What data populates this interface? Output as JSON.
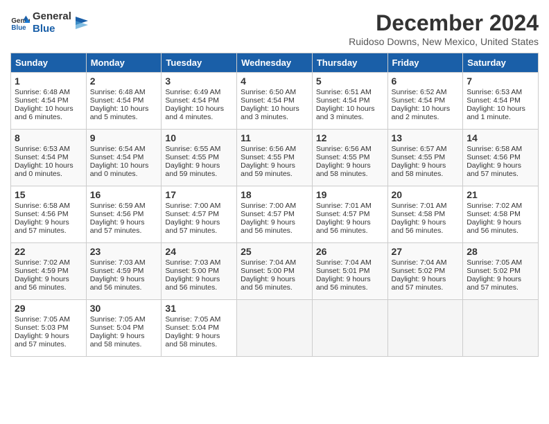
{
  "header": {
    "logo_line1": "General",
    "logo_line2": "Blue",
    "month": "December 2024",
    "location": "Ruidoso Downs, New Mexico, United States"
  },
  "weekdays": [
    "Sunday",
    "Monday",
    "Tuesday",
    "Wednesday",
    "Thursday",
    "Friday",
    "Saturday"
  ],
  "weeks": [
    [
      {
        "day": "1",
        "lines": [
          "Sunrise: 6:48 AM",
          "Sunset: 4:54 PM",
          "Daylight: 10 hours",
          "and 6 minutes."
        ]
      },
      {
        "day": "2",
        "lines": [
          "Sunrise: 6:48 AM",
          "Sunset: 4:54 PM",
          "Daylight: 10 hours",
          "and 5 minutes."
        ]
      },
      {
        "day": "3",
        "lines": [
          "Sunrise: 6:49 AM",
          "Sunset: 4:54 PM",
          "Daylight: 10 hours",
          "and 4 minutes."
        ]
      },
      {
        "day": "4",
        "lines": [
          "Sunrise: 6:50 AM",
          "Sunset: 4:54 PM",
          "Daylight: 10 hours",
          "and 3 minutes."
        ]
      },
      {
        "day": "5",
        "lines": [
          "Sunrise: 6:51 AM",
          "Sunset: 4:54 PM",
          "Daylight: 10 hours",
          "and 3 minutes."
        ]
      },
      {
        "day": "6",
        "lines": [
          "Sunrise: 6:52 AM",
          "Sunset: 4:54 PM",
          "Daylight: 10 hours",
          "and 2 minutes."
        ]
      },
      {
        "day": "7",
        "lines": [
          "Sunrise: 6:53 AM",
          "Sunset: 4:54 PM",
          "Daylight: 10 hours",
          "and 1 minute."
        ]
      }
    ],
    [
      {
        "day": "8",
        "lines": [
          "Sunrise: 6:53 AM",
          "Sunset: 4:54 PM",
          "Daylight: 10 hours",
          "and 0 minutes."
        ]
      },
      {
        "day": "9",
        "lines": [
          "Sunrise: 6:54 AM",
          "Sunset: 4:54 PM",
          "Daylight: 10 hours",
          "and 0 minutes."
        ]
      },
      {
        "day": "10",
        "lines": [
          "Sunrise: 6:55 AM",
          "Sunset: 4:55 PM",
          "Daylight: 9 hours",
          "and 59 minutes."
        ]
      },
      {
        "day": "11",
        "lines": [
          "Sunrise: 6:56 AM",
          "Sunset: 4:55 PM",
          "Daylight: 9 hours",
          "and 59 minutes."
        ]
      },
      {
        "day": "12",
        "lines": [
          "Sunrise: 6:56 AM",
          "Sunset: 4:55 PM",
          "Daylight: 9 hours",
          "and 58 minutes."
        ]
      },
      {
        "day": "13",
        "lines": [
          "Sunrise: 6:57 AM",
          "Sunset: 4:55 PM",
          "Daylight: 9 hours",
          "and 58 minutes."
        ]
      },
      {
        "day": "14",
        "lines": [
          "Sunrise: 6:58 AM",
          "Sunset: 4:56 PM",
          "Daylight: 9 hours",
          "and 57 minutes."
        ]
      }
    ],
    [
      {
        "day": "15",
        "lines": [
          "Sunrise: 6:58 AM",
          "Sunset: 4:56 PM",
          "Daylight: 9 hours",
          "and 57 minutes."
        ]
      },
      {
        "day": "16",
        "lines": [
          "Sunrise: 6:59 AM",
          "Sunset: 4:56 PM",
          "Daylight: 9 hours",
          "and 57 minutes."
        ]
      },
      {
        "day": "17",
        "lines": [
          "Sunrise: 7:00 AM",
          "Sunset: 4:57 PM",
          "Daylight: 9 hours",
          "and 57 minutes."
        ]
      },
      {
        "day": "18",
        "lines": [
          "Sunrise: 7:00 AM",
          "Sunset: 4:57 PM",
          "Daylight: 9 hours",
          "and 56 minutes."
        ]
      },
      {
        "day": "19",
        "lines": [
          "Sunrise: 7:01 AM",
          "Sunset: 4:57 PM",
          "Daylight: 9 hours",
          "and 56 minutes."
        ]
      },
      {
        "day": "20",
        "lines": [
          "Sunrise: 7:01 AM",
          "Sunset: 4:58 PM",
          "Daylight: 9 hours",
          "and 56 minutes."
        ]
      },
      {
        "day": "21",
        "lines": [
          "Sunrise: 7:02 AM",
          "Sunset: 4:58 PM",
          "Daylight: 9 hours",
          "and 56 minutes."
        ]
      }
    ],
    [
      {
        "day": "22",
        "lines": [
          "Sunrise: 7:02 AM",
          "Sunset: 4:59 PM",
          "Daylight: 9 hours",
          "and 56 minutes."
        ]
      },
      {
        "day": "23",
        "lines": [
          "Sunrise: 7:03 AM",
          "Sunset: 4:59 PM",
          "Daylight: 9 hours",
          "and 56 minutes."
        ]
      },
      {
        "day": "24",
        "lines": [
          "Sunrise: 7:03 AM",
          "Sunset: 5:00 PM",
          "Daylight: 9 hours",
          "and 56 minutes."
        ]
      },
      {
        "day": "25",
        "lines": [
          "Sunrise: 7:04 AM",
          "Sunset: 5:00 PM",
          "Daylight: 9 hours",
          "and 56 minutes."
        ]
      },
      {
        "day": "26",
        "lines": [
          "Sunrise: 7:04 AM",
          "Sunset: 5:01 PM",
          "Daylight: 9 hours",
          "and 56 minutes."
        ]
      },
      {
        "day": "27",
        "lines": [
          "Sunrise: 7:04 AM",
          "Sunset: 5:02 PM",
          "Daylight: 9 hours",
          "and 57 minutes."
        ]
      },
      {
        "day": "28",
        "lines": [
          "Sunrise: 7:05 AM",
          "Sunset: 5:02 PM",
          "Daylight: 9 hours",
          "and 57 minutes."
        ]
      }
    ],
    [
      {
        "day": "29",
        "lines": [
          "Sunrise: 7:05 AM",
          "Sunset: 5:03 PM",
          "Daylight: 9 hours",
          "and 57 minutes."
        ]
      },
      {
        "day": "30",
        "lines": [
          "Sunrise: 7:05 AM",
          "Sunset: 5:04 PM",
          "Daylight: 9 hours",
          "and 58 minutes."
        ]
      },
      {
        "day": "31",
        "lines": [
          "Sunrise: 7:05 AM",
          "Sunset: 5:04 PM",
          "Daylight: 9 hours",
          "and 58 minutes."
        ]
      },
      null,
      null,
      null,
      null
    ]
  ]
}
